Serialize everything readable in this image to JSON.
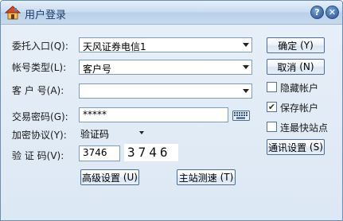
{
  "window": {
    "title": "用户登录",
    "help_label": "?",
    "close_label": "✕",
    "accent_color": "#3c6aa6"
  },
  "form": {
    "broker_label": "委托入口",
    "broker_key": "(Q):",
    "broker_value": "天风证券电信1",
    "account_type_label": "帐号类型",
    "account_type_key": "(L):",
    "account_type_value": "客户号",
    "account_label": "客 户 号",
    "account_key": "(A):",
    "account_value": "",
    "password_label": "交易密码",
    "password_key": "(G):",
    "password_value": "*****",
    "encryption_label": "加密协议",
    "encryption_key": "(Y):",
    "encryption_value": "验证码",
    "captcha_label": "验 证 码",
    "captcha_key": "(V):",
    "captcha_input": "3746",
    "captcha_image_text": "3746"
  },
  "buttons": {
    "confirm": "确定",
    "confirm_key": "(Y)",
    "cancel": "取消",
    "cancel_key": "(N)",
    "comm_settings": "通讯设置",
    "comm_settings_key": "(S)",
    "advanced": "高级设置",
    "advanced_key": "(U)",
    "speed_test": "主站测速",
    "speed_test_key": "(T)"
  },
  "options": {
    "hide_account": {
      "label": "隐藏帐户",
      "checked": false
    },
    "save_account": {
      "label": "保存帐户",
      "checked": true,
      "mark": "✔"
    },
    "fastest_site": {
      "label": "连最快站点",
      "checked": false
    }
  }
}
